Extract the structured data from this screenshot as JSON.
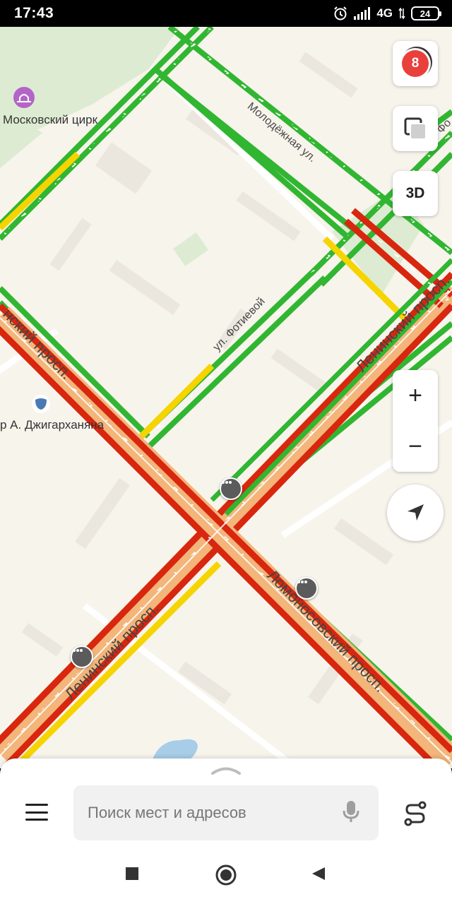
{
  "status_bar": {
    "time": "17:43",
    "network": "4G",
    "battery": "24",
    "icons": [
      "alarm-icon",
      "signal-icon",
      "battery-icon"
    ]
  },
  "map": {
    "poi_circus": "Московский цирк",
    "poi_theatre": "р А. Джигарханяна",
    "streets": {
      "molodezhnaya": "Молодёжная ул.",
      "fotievoy": "ул. Фотиевой",
      "leninsky_top": "Ленинский просп.",
      "leninsky_left": "нский просп.",
      "leninsky_bottom": "Ленинский просп.",
      "lomonosovsky": "Ломоносовский просп.",
      "fragment_right": "Фо"
    },
    "traffic_colors": {
      "green": "#31b631",
      "yellow": "#f6d400",
      "red": "#d8260f",
      "orange_fill": "#f3b57a"
    }
  },
  "controls": {
    "traffic_level": "8",
    "btn_3d": "3D",
    "zoom_in": "+",
    "zoom_out": "−"
  },
  "search": {
    "placeholder": "Поиск мест и адресов"
  }
}
